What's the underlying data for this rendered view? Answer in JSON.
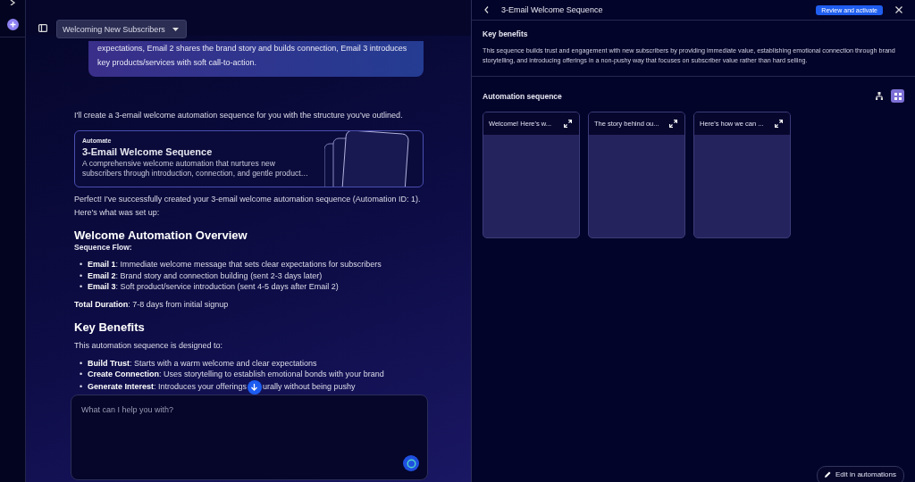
{
  "conversation_dropdown": {
    "label": "Welcoming New Subscribers"
  },
  "user_message": {
    "text": "expectations, Email 2 shares the brand story and builds connection, Email 3 introduces key products/services with soft call-to-action."
  },
  "assistant_intro": "I'll create a 3-email welcome automation sequence for you with the structure you've outlined.",
  "automation_card": {
    "eyebrow": "Automate",
    "title": "3-Email Welcome Sequence",
    "description": "A comprehensive welcome automation that nurtures new subscribers through introduction, connection, and gentle product…"
  },
  "response": [
    {
      "kind": "paragraph",
      "text": "Perfect! I've successfully created your 3-email welcome automation sequence (Automation ID: 1). Here's what was set up:"
    },
    {
      "kind": "heading",
      "text": "Welcome Automation Overview"
    },
    {
      "kind": "subheading",
      "text": "Sequence Flow:"
    },
    {
      "kind": "list",
      "bullet": "•",
      "items": [
        "**Email 1**: Immediate welcome message that sets clear expectations for subscribers",
        "**Email 2**: Brand story and connection building (sent 2-3 days later)",
        "**Email 3**: Soft product/service introduction (sent 4-5 days after Email 2)"
      ]
    },
    {
      "kind": "paragraph",
      "text": "**Total Duration**: 7-8 days from initial signup"
    },
    {
      "kind": "heading",
      "text": "Key Benefits"
    },
    {
      "kind": "paragraph",
      "text": "This automation sequence is designed to:"
    },
    {
      "kind": "list",
      "bullet": "•",
      "items": [
        "**Build Trust**: Starts with a warm welcome and clear expectations",
        "**Create Connection**: Uses storytelling to establish emotional bonds with your brand"
      ],
      "covered_item": {
        "before": "**Generate Interest**: Introduces your offerings",
        "after": "urally without being pushy"
      }
    }
  ],
  "chat_input": {
    "placeholder": "What can I help you with?"
  },
  "panel": {
    "title": "3-Email Welcome Sequence",
    "action": "Review and activate",
    "key_benefits": {
      "heading": "Key benefits",
      "text": "This sequence builds trust and engagement with new subscribers by providing immediate value, establishing emotional connection through brand storytelling, and introducing offerings in a non-pushy way that focuses on subscriber value rather than hard selling."
    },
    "sequence": {
      "heading": "Automation sequence",
      "views": [
        {
          "kind": "flow",
          "selected": false
        },
        {
          "kind": "grid",
          "selected": true
        }
      ],
      "emails": [
        {
          "title": "Welcome! Here's w..."
        },
        {
          "title": "The story behind ou..."
        },
        {
          "title": "Here's how we can ..."
        }
      ]
    },
    "edit_button": "Edit in automations"
  }
}
